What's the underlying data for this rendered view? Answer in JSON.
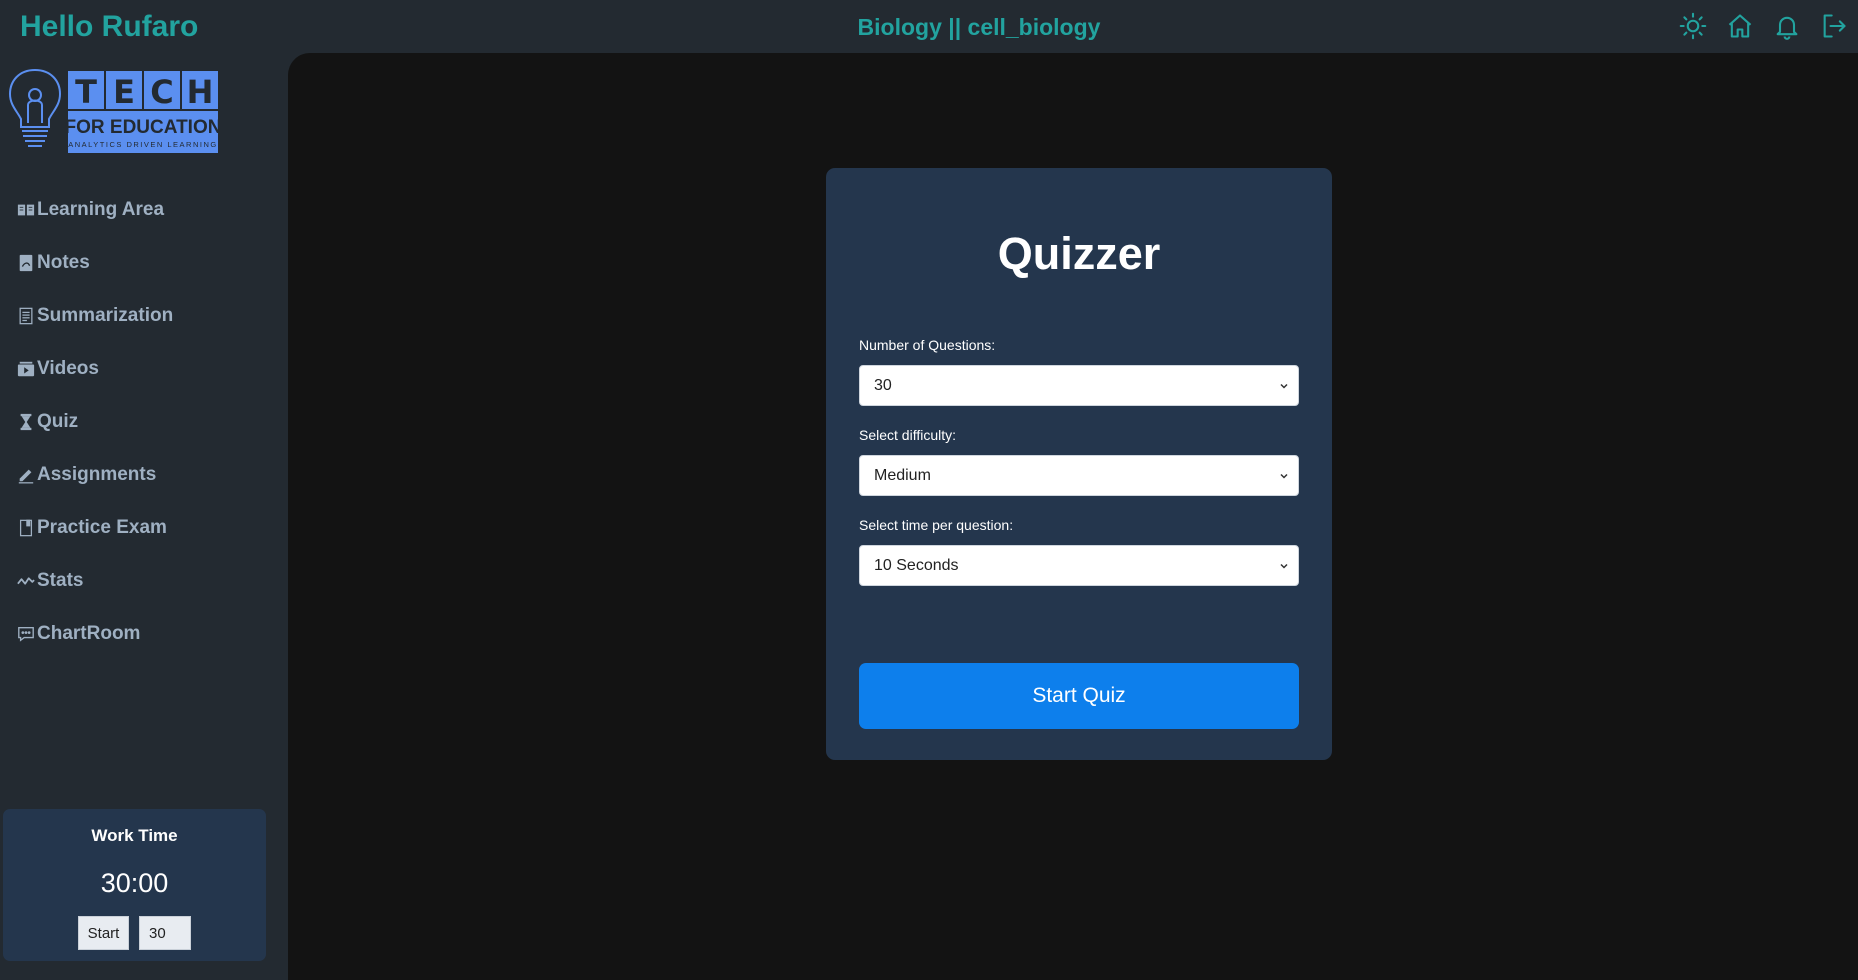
{
  "header": {
    "greeting": "Hello Rufaro",
    "subject": "Biology || cell_biology",
    "icons": [
      "sun-icon",
      "home-icon",
      "bell-icon",
      "logout-icon"
    ]
  },
  "logo": {
    "line1": "TECH",
    "line2": "FOR EDUCATION",
    "tagline": "ANALYTICS DRIVEN LEARNING"
  },
  "sidebar": {
    "items": [
      {
        "label": "Learning Area",
        "icon": "book-open-icon"
      },
      {
        "label": "Notes",
        "icon": "pdf-file-icon"
      },
      {
        "label": "Summarization",
        "icon": "document-icon"
      },
      {
        "label": "Videos",
        "icon": "video-icon"
      },
      {
        "label": "Quiz",
        "icon": "hourglass-icon"
      },
      {
        "label": "Assignments",
        "icon": "pencil-icon"
      },
      {
        "label": "Practice Exam",
        "icon": "notebook-icon"
      },
      {
        "label": "Stats",
        "icon": "activity-icon"
      },
      {
        "label": "ChartRoom",
        "icon": "chat-icon"
      }
    ]
  },
  "worktime": {
    "title": "Work Time",
    "clock": "30:00",
    "start_label": "Start",
    "minutes_value": "30"
  },
  "quiz": {
    "title": "Quizzer",
    "questions_label": "Number of Questions:",
    "questions_value": "30",
    "difficulty_label": "Select difficulty:",
    "difficulty_value": "Medium",
    "time_label": "Select time per question:",
    "time_value": "10 Seconds",
    "start_label": "Start Quiz"
  },
  "colors": {
    "accent_teal": "#22a39f",
    "nav_text": "#9fb0c2",
    "card_bg": "#24364d",
    "main_bg": "#131313",
    "button_blue": "#0d7fec",
    "logo_blue": "#5b8ff0"
  }
}
